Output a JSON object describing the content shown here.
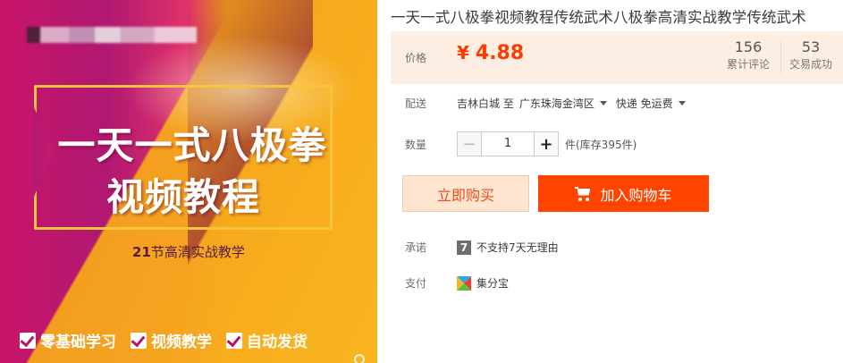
{
  "product_image": {
    "title_line_1": "一天一式八极拳",
    "title_line_2": "视频教程",
    "subtitle_num": "21",
    "subtitle_text": "节高清实战教学",
    "features": [
      "零基础学习",
      "视频教学",
      "自动发货"
    ]
  },
  "product": {
    "title": "一天一式八极拳视频教程传统武术八极拳高清实战教学传统武术"
  },
  "price": {
    "label": "价格",
    "currency": "¥",
    "amount": "4.88",
    "reviews_count": "156",
    "reviews_label": "累计评论",
    "trades_count": "53",
    "trades_label": "交易成功"
  },
  "shipping": {
    "label": "配送",
    "from": "吉林白城 至",
    "to": "广东珠海金湾区",
    "method": "快递 免运费"
  },
  "quantity": {
    "label": "数量",
    "minus": "−",
    "value": "1",
    "plus": "+",
    "stock": "件(库存395件)"
  },
  "actions": {
    "buy_now": "立即购买",
    "add_to_cart": "加入购物车"
  },
  "promise": {
    "label": "承诺",
    "badge": "7",
    "text": "不支持7天无理由"
  },
  "payment": {
    "label": "支付",
    "method": "集分宝"
  },
  "colors": {
    "price": "#ff3c00",
    "add_cart_bg": "#ff4400",
    "buy_now_bg": "#ffe4d0",
    "price_panel_bg": "#fdeee4"
  }
}
